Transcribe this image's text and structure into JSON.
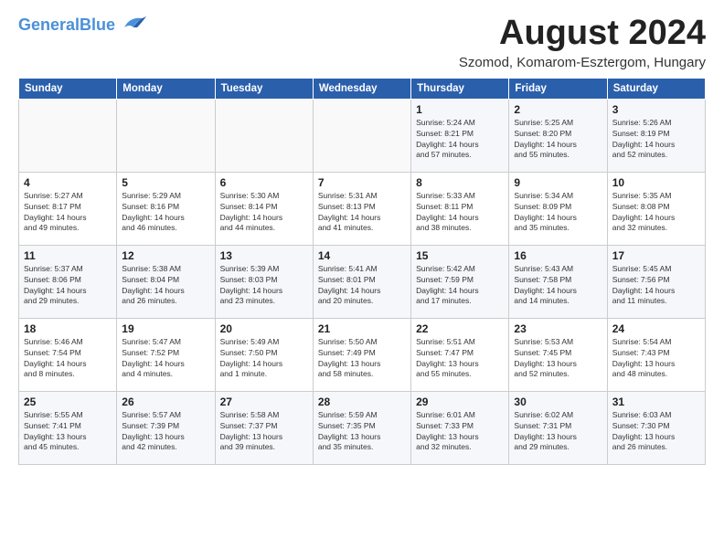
{
  "header": {
    "logo_line1": "General",
    "logo_line2": "Blue",
    "month_title": "August 2024",
    "subtitle": "Szomod, Komarom-Esztergom, Hungary"
  },
  "weekdays": [
    "Sunday",
    "Monday",
    "Tuesday",
    "Wednesday",
    "Thursday",
    "Friday",
    "Saturday"
  ],
  "weeks": [
    [
      {
        "day": "",
        "info": ""
      },
      {
        "day": "",
        "info": ""
      },
      {
        "day": "",
        "info": ""
      },
      {
        "day": "",
        "info": ""
      },
      {
        "day": "1",
        "info": "Sunrise: 5:24 AM\nSunset: 8:21 PM\nDaylight: 14 hours\nand 57 minutes."
      },
      {
        "day": "2",
        "info": "Sunrise: 5:25 AM\nSunset: 8:20 PM\nDaylight: 14 hours\nand 55 minutes."
      },
      {
        "day": "3",
        "info": "Sunrise: 5:26 AM\nSunset: 8:19 PM\nDaylight: 14 hours\nand 52 minutes."
      }
    ],
    [
      {
        "day": "4",
        "info": "Sunrise: 5:27 AM\nSunset: 8:17 PM\nDaylight: 14 hours\nand 49 minutes."
      },
      {
        "day": "5",
        "info": "Sunrise: 5:29 AM\nSunset: 8:16 PM\nDaylight: 14 hours\nand 46 minutes."
      },
      {
        "day": "6",
        "info": "Sunrise: 5:30 AM\nSunset: 8:14 PM\nDaylight: 14 hours\nand 44 minutes."
      },
      {
        "day": "7",
        "info": "Sunrise: 5:31 AM\nSunset: 8:13 PM\nDaylight: 14 hours\nand 41 minutes."
      },
      {
        "day": "8",
        "info": "Sunrise: 5:33 AM\nSunset: 8:11 PM\nDaylight: 14 hours\nand 38 minutes."
      },
      {
        "day": "9",
        "info": "Sunrise: 5:34 AM\nSunset: 8:09 PM\nDaylight: 14 hours\nand 35 minutes."
      },
      {
        "day": "10",
        "info": "Sunrise: 5:35 AM\nSunset: 8:08 PM\nDaylight: 14 hours\nand 32 minutes."
      }
    ],
    [
      {
        "day": "11",
        "info": "Sunrise: 5:37 AM\nSunset: 8:06 PM\nDaylight: 14 hours\nand 29 minutes."
      },
      {
        "day": "12",
        "info": "Sunrise: 5:38 AM\nSunset: 8:04 PM\nDaylight: 14 hours\nand 26 minutes."
      },
      {
        "day": "13",
        "info": "Sunrise: 5:39 AM\nSunset: 8:03 PM\nDaylight: 14 hours\nand 23 minutes."
      },
      {
        "day": "14",
        "info": "Sunrise: 5:41 AM\nSunset: 8:01 PM\nDaylight: 14 hours\nand 20 minutes."
      },
      {
        "day": "15",
        "info": "Sunrise: 5:42 AM\nSunset: 7:59 PM\nDaylight: 14 hours\nand 17 minutes."
      },
      {
        "day": "16",
        "info": "Sunrise: 5:43 AM\nSunset: 7:58 PM\nDaylight: 14 hours\nand 14 minutes."
      },
      {
        "day": "17",
        "info": "Sunrise: 5:45 AM\nSunset: 7:56 PM\nDaylight: 14 hours\nand 11 minutes."
      }
    ],
    [
      {
        "day": "18",
        "info": "Sunrise: 5:46 AM\nSunset: 7:54 PM\nDaylight: 14 hours\nand 8 minutes."
      },
      {
        "day": "19",
        "info": "Sunrise: 5:47 AM\nSunset: 7:52 PM\nDaylight: 14 hours\nand 4 minutes."
      },
      {
        "day": "20",
        "info": "Sunrise: 5:49 AM\nSunset: 7:50 PM\nDaylight: 14 hours\nand 1 minute."
      },
      {
        "day": "21",
        "info": "Sunrise: 5:50 AM\nSunset: 7:49 PM\nDaylight: 13 hours\nand 58 minutes."
      },
      {
        "day": "22",
        "info": "Sunrise: 5:51 AM\nSunset: 7:47 PM\nDaylight: 13 hours\nand 55 minutes."
      },
      {
        "day": "23",
        "info": "Sunrise: 5:53 AM\nSunset: 7:45 PM\nDaylight: 13 hours\nand 52 minutes."
      },
      {
        "day": "24",
        "info": "Sunrise: 5:54 AM\nSunset: 7:43 PM\nDaylight: 13 hours\nand 48 minutes."
      }
    ],
    [
      {
        "day": "25",
        "info": "Sunrise: 5:55 AM\nSunset: 7:41 PM\nDaylight: 13 hours\nand 45 minutes."
      },
      {
        "day": "26",
        "info": "Sunrise: 5:57 AM\nSunset: 7:39 PM\nDaylight: 13 hours\nand 42 minutes."
      },
      {
        "day": "27",
        "info": "Sunrise: 5:58 AM\nSunset: 7:37 PM\nDaylight: 13 hours\nand 39 minutes."
      },
      {
        "day": "28",
        "info": "Sunrise: 5:59 AM\nSunset: 7:35 PM\nDaylight: 13 hours\nand 35 minutes."
      },
      {
        "day": "29",
        "info": "Sunrise: 6:01 AM\nSunset: 7:33 PM\nDaylight: 13 hours\nand 32 minutes."
      },
      {
        "day": "30",
        "info": "Sunrise: 6:02 AM\nSunset: 7:31 PM\nDaylight: 13 hours\nand 29 minutes."
      },
      {
        "day": "31",
        "info": "Sunrise: 6:03 AM\nSunset: 7:30 PM\nDaylight: 13 hours\nand 26 minutes."
      }
    ]
  ]
}
